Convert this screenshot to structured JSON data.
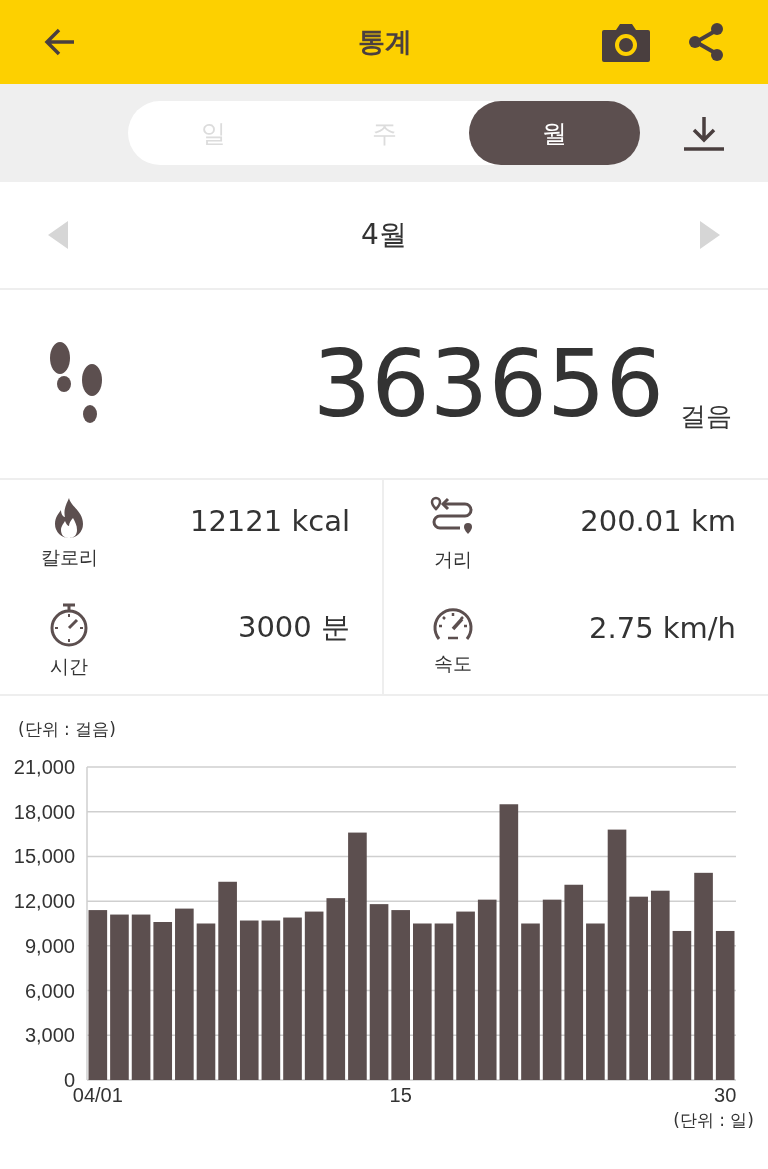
{
  "app_bar": {
    "title": "통계"
  },
  "period_tabs": [
    {
      "label": "일",
      "selected": false
    },
    {
      "label": "주",
      "selected": false
    },
    {
      "label": "월",
      "selected": true
    }
  ],
  "month_nav": {
    "label": "4월"
  },
  "steps": {
    "value": "363656",
    "unit": "걸음"
  },
  "stats": [
    {
      "kind": "calorie",
      "label": "칼로리",
      "value": "12121 kcal"
    },
    {
      "kind": "distance",
      "label": "거리",
      "value": "200.01 km"
    },
    {
      "kind": "time",
      "label": "시간",
      "value": "3000 분"
    },
    {
      "kind": "speed",
      "label": "속도",
      "value": "2.75 km/h"
    }
  ],
  "chart": {
    "y_unit": "(단위 : 걸음)",
    "x_unit": "(단위 : 일)",
    "chart_data": {
      "type": "bar",
      "x": [
        1,
        2,
        3,
        4,
        5,
        6,
        7,
        8,
        9,
        10,
        11,
        12,
        13,
        14,
        15,
        16,
        17,
        18,
        19,
        20,
        21,
        22,
        23,
        24,
        25,
        26,
        27,
        28,
        29,
        30
      ],
      "values": [
        11400,
        11100,
        11100,
        10600,
        11500,
        10500,
        13300,
        10700,
        10700,
        10900,
        11300,
        12200,
        16600,
        11800,
        11400,
        10500,
        10500,
        11300,
        12100,
        18500,
        10500,
        12100,
        13100,
        10500,
        16800,
        12300,
        12700,
        10000,
        13900,
        10000
      ],
      "xlim": [
        0.5,
        30.5
      ],
      "grid": true,
      "ylim": [
        0,
        21000
      ],
      "yticks": [
        {
          "value": 0,
          "label": "0"
        },
        {
          "value": 3000,
          "label": "3,000"
        },
        {
          "value": 6000,
          "label": "6,000"
        },
        {
          "value": 9000,
          "label": "9,000"
        },
        {
          "value": 12000,
          "label": "12,000"
        },
        {
          "value": 15000,
          "label": "15,000"
        },
        {
          "value": 18000,
          "label": "18,000"
        },
        {
          "value": 21000,
          "label": "21,000"
        }
      ],
      "xticks": [
        {
          "value": 1,
          "label": "04/01"
        },
        {
          "value": 15,
          "label": "15"
        },
        {
          "value": 30,
          "label": "30"
        }
      ],
      "color": "#5c4f4f"
    }
  }
}
